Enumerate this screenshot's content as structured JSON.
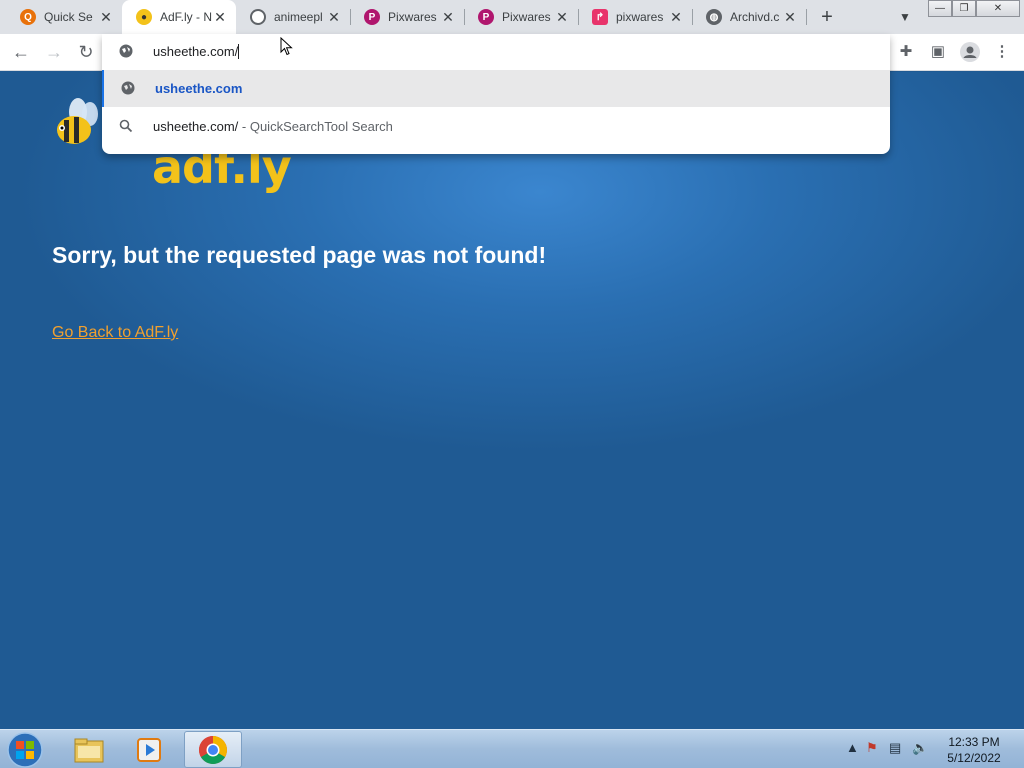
{
  "browser": {
    "tabs": [
      {
        "title": "Quick Se",
        "favicon": "quick-search-icon",
        "color": "#e8710a"
      },
      {
        "title": "AdF.ly - N",
        "favicon": "adfly-bee-icon",
        "color": "#f3c21a",
        "active": true
      },
      {
        "title": "animeepl",
        "favicon": "globe-icon",
        "color": "#5f6368"
      },
      {
        "title": "Pixwares",
        "favicon": "pixwares-icon",
        "color": "#b0166e"
      },
      {
        "title": "Pixwares",
        "favicon": "pixwares-icon",
        "color": "#b0166e"
      },
      {
        "title": "pixwares",
        "favicon": "redirect-icon",
        "color": "#e8336b"
      },
      {
        "title": "Archivd.c",
        "favicon": "globe-icon",
        "color": "#5f6368"
      }
    ],
    "omnibox": {
      "value": "usheethe.com/",
      "suggestions": [
        {
          "url": "usheethe.com",
          "icon": "globe-icon",
          "selected": true
        },
        {
          "query": "usheethe.com/",
          "description": " - QuickSearchTool Search",
          "icon": "search-icon"
        }
      ]
    }
  },
  "page": {
    "logo_text": "adf.ly",
    "heading": "Sorry, but the requested page was not found!",
    "back_link": "Go Back to AdF.ly",
    "link_color": "#f0a030"
  },
  "taskbar": {
    "time": "12:33 PM",
    "date": "5/12/2022"
  }
}
